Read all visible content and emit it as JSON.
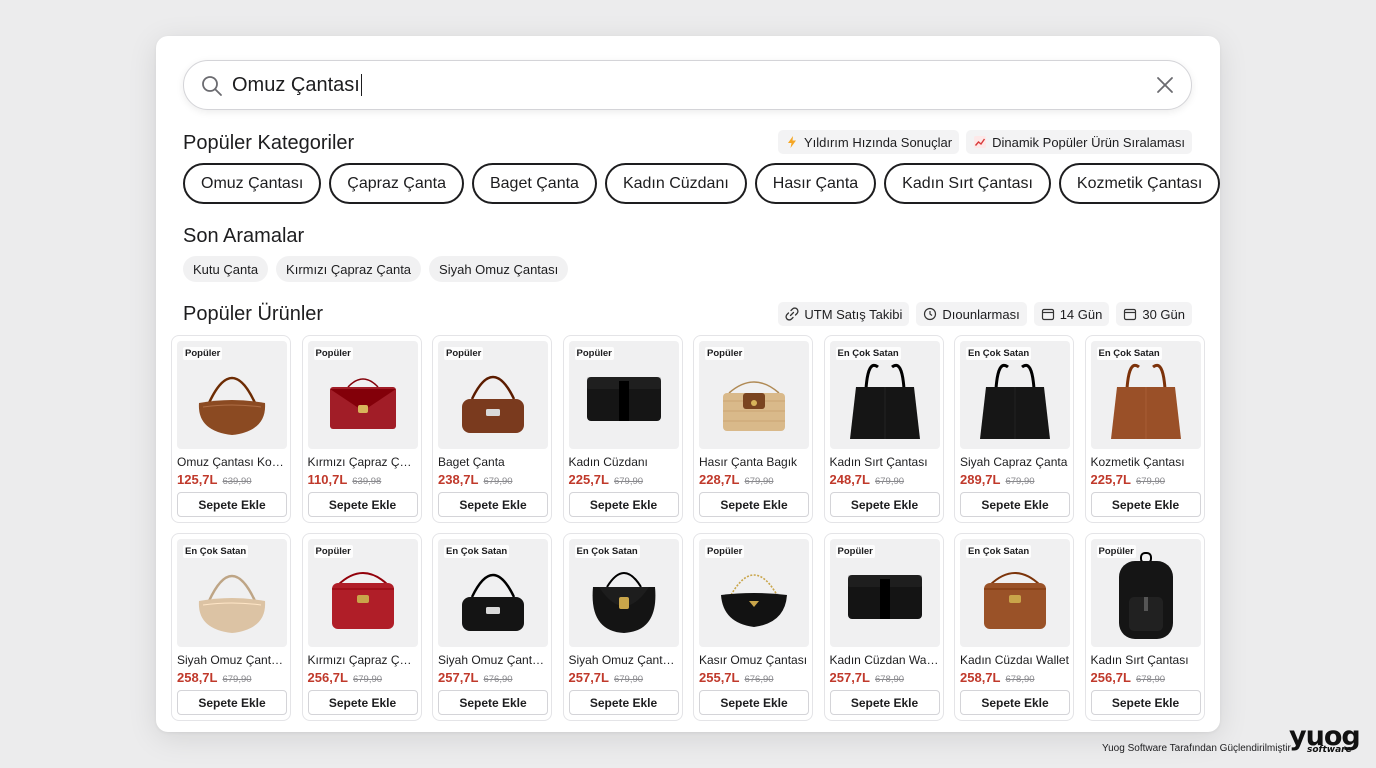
{
  "search": {
    "value": "Omuz Çantası",
    "icon": "search-icon",
    "clear_icon": "close-icon"
  },
  "categories": {
    "title": "Popüler Kategoriler",
    "badges": [
      {
        "icon": "lightning-icon",
        "label": "Yıldırım Hızında Sonuçlar"
      },
      {
        "icon": "chart-up-icon",
        "label": "Dinamik Popüler Ürün Sıralaması"
      }
    ],
    "chips": [
      "Omuz Çantası",
      "Çapraz Çanta",
      "Baget Çanta",
      "Kadın Cüzdanı",
      "Hasır Çanta",
      "Kadın Sırt Çantası",
      "Kozmetik Çantası"
    ]
  },
  "recent": {
    "title": "Son Aramalar",
    "chips": [
      "Kutu Çanta",
      "Kırmızı Çapraz Çanta",
      "Siyah Omuz Çantası"
    ]
  },
  "products": {
    "title": "Popüler Ürünler",
    "badges": [
      {
        "icon": "link-icon",
        "label": "UTM Satış Takibi"
      },
      {
        "icon": "clock-icon",
        "label": "Dıounlarması"
      },
      {
        "icon": "calendar-icon",
        "label": "14 Gün"
      },
      {
        "icon": "calendar-icon",
        "label": "30 Gün"
      }
    ],
    "button_label": "Sepete Ekle",
    "items": [
      {
        "tag": "Popüler",
        "name": "Omuz Çantası Kombin",
        "price": "125,7L",
        "old": "639,90",
        "color": "#8b4a22",
        "shape": "hobo"
      },
      {
        "tag": "Popüler",
        "name": "Kırmızı Çapraz Çanta",
        "price": "110,7L",
        "old": "639,98",
        "color": "#a11d27",
        "shape": "flap"
      },
      {
        "tag": "Popüler",
        "name": "Baget Çanta",
        "price": "238,7L",
        "old": "679,90",
        "color": "#7a3a1e",
        "shape": "baguette"
      },
      {
        "tag": "Popüler",
        "name": "Kadın Cüzdanı",
        "price": "225,7L",
        "old": "679,90",
        "color": "#151515",
        "shape": "wallet"
      },
      {
        "tag": "Popüler",
        "name": "Hasır Çanta Bagık",
        "price": "228,7L",
        "old": "679,90",
        "color": "#d9b98a",
        "shape": "straw"
      },
      {
        "tag": "En Çok Satan",
        "name": "Kadın Sırt Çantası",
        "price": "248,7L",
        "old": "679,90",
        "color": "#151515",
        "shape": "tote"
      },
      {
        "tag": "En Çok Satan",
        "name": "Siyah Capraz Çanta",
        "price": "289,7L",
        "old": "679,90",
        "color": "#161616",
        "shape": "tote"
      },
      {
        "tag": "En Çok Satan",
        "name": "Kozmetik Çantası",
        "price": "225,7L",
        "old": "679,90",
        "color": "#9a5028",
        "shape": "tote"
      },
      {
        "tag": "En Çok Satan",
        "name": "Siyah Omuz Çantası",
        "price": "258,7L",
        "old": "679,90",
        "color": "#dcc3a4",
        "shape": "hobo"
      },
      {
        "tag": "Popüler",
        "name": "Kırmızı Çapraz Çanta",
        "price": "256,7L",
        "old": "679,90",
        "color": "#b01e28",
        "shape": "box"
      },
      {
        "tag": "En Çok Satan",
        "name": "Siyah Omuz Çantası",
        "price": "257,7L",
        "old": "676,90",
        "color": "#141414",
        "shape": "baguette"
      },
      {
        "tag": "En Çok Satan",
        "name": "Siyah Omuz Çantası",
        "price": "257,7L",
        "old": "679,90",
        "color": "#141414",
        "shape": "saddle"
      },
      {
        "tag": "Popüler",
        "name": "Kasır Omuz Çantası",
        "price": "255,7L",
        "old": "676,90",
        "color": "#121212",
        "shape": "chain"
      },
      {
        "tag": "Popüler",
        "name": "Kadın Cüzdan Wallet",
        "price": "257,7L",
        "old": "678,90",
        "color": "#141414",
        "shape": "wallet"
      },
      {
        "tag": "En Çok Satan",
        "name": "Kadın Cüzdaı Wallet",
        "price": "258,7L",
        "old": "678,90",
        "color": "#9a5228",
        "shape": "box"
      },
      {
        "tag": "Popüler",
        "name": "Kadın Sırt Çantası",
        "price": "256,7L",
        "old": "678,90",
        "color": "#151515",
        "shape": "backpack"
      }
    ]
  },
  "footer": {
    "text": "Yuog Software Tarafından Güçlendirilmiştir",
    "logo_main": "yuog",
    "logo_sub": "software"
  }
}
